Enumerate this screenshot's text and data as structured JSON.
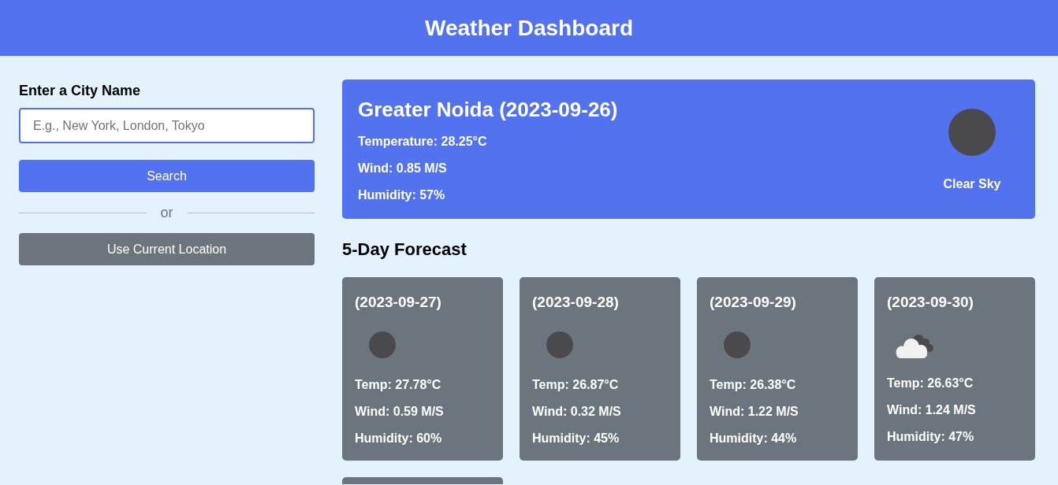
{
  "header": {
    "title": "Weather Dashboard"
  },
  "search_panel": {
    "label": "Enter a City Name",
    "input": {
      "placeholder": "E.g., New York, London, Tokyo"
    },
    "search_button": "Search",
    "divider_text": "or",
    "location_button": "Use Current Location"
  },
  "current_weather": {
    "title": "Greater Noida (2023-09-26)",
    "details": [
      "Temperature: 28.25°C",
      "Wind: 0.85 M/S",
      "Humidity: 57%"
    ],
    "description": "Clear Sky"
  },
  "forecast": {
    "title": "5-Day Forecast",
    "cards": [
      {
        "kind": "clear",
        "date": "(2023-09-27)",
        "details": [
          "Temp: 27.78°C",
          "Wind: 0.59 M/S",
          "Humidity: 60%"
        ]
      },
      {
        "kind": "clear",
        "date": "(2023-09-28)",
        "details": [
          "Temp: 26.87°C",
          "Wind: 0.32 M/S",
          "Humidity: 45%"
        ]
      },
      {
        "kind": "clear",
        "date": "(2023-09-29)",
        "details": [
          "Temp: 26.38°C",
          "Wind: 1.22 M/S",
          "Humidity: 44%"
        ]
      },
      {
        "kind": "clouds",
        "date": "(2023-09-30)",
        "details": [
          "Temp: 26.63°C",
          "Wind: 1.24 M/S",
          "Humidity: 47%"
        ]
      },
      {
        "kind": "clipped"
      }
    ]
  }
}
